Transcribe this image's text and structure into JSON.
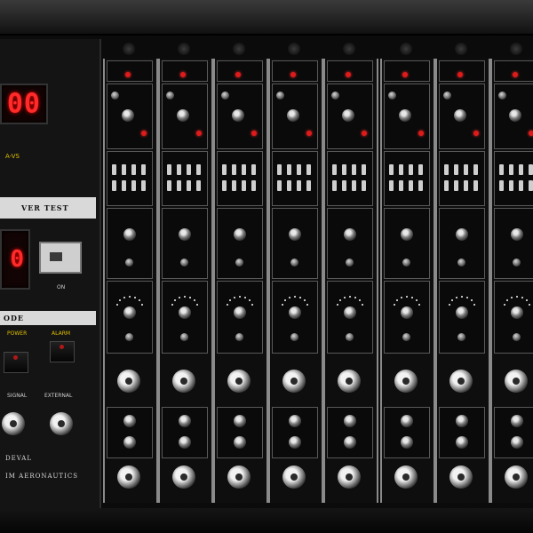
{
  "left_module": {
    "main_display_value": "00",
    "main_display_unit": "A-VS",
    "band_label": "VER TEST",
    "sub_display_value": "0",
    "switch_caption": "ON",
    "band2_label": "ODE",
    "button1_label": "POWER",
    "button2_label": "ALARM",
    "connector1_label": "SIGNAL",
    "connector2_label": "EXTERNAL",
    "brand_line1": "DEVAL",
    "brand_line2": "IM AERONAUTICS"
  },
  "channels": [
    {
      "id": 1
    },
    {
      "id": 2
    },
    {
      "id": 3
    },
    {
      "id": 4
    },
    {
      "id": 5
    },
    {
      "id": 6
    },
    {
      "id": 7
    },
    {
      "id": 8
    }
  ],
  "colors": {
    "led_red": "#ff2a2a",
    "panel_black": "#0b0b0b",
    "module_border": "#8a8a8a",
    "label_band": "#d9d9d9"
  },
  "icons": [
    "bnc-connector-icon",
    "knob-icon",
    "led-indicator-icon",
    "toggle-switch-icon"
  ]
}
